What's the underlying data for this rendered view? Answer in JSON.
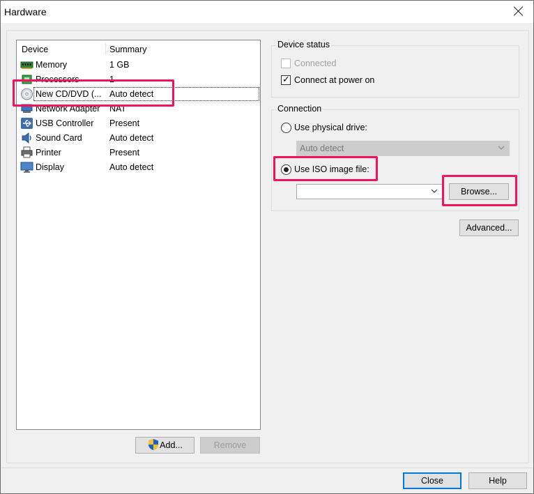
{
  "window": {
    "title": "Hardware"
  },
  "device_list": {
    "columns": {
      "device": "Device",
      "summary": "Summary"
    },
    "rows": [
      {
        "device": "Memory",
        "summary": "1 GB",
        "icon": "memory-icon"
      },
      {
        "device": "Processors",
        "summary": "1",
        "icon": "processor-icon"
      },
      {
        "device": "New CD/DVD (...",
        "summary": "Auto detect",
        "icon": "cd-dvd-icon"
      },
      {
        "device": "Network Adapter",
        "summary": "NAT",
        "icon": "network-adapter-icon"
      },
      {
        "device": "USB Controller",
        "summary": "Present",
        "icon": "usb-icon"
      },
      {
        "device": "Sound Card",
        "summary": "Auto detect",
        "icon": "sound-card-icon"
      },
      {
        "device": "Printer",
        "summary": "Present",
        "icon": "printer-icon"
      },
      {
        "device": "Display",
        "summary": "Auto detect",
        "icon": "display-icon"
      }
    ],
    "selected_index": 2
  },
  "list_buttons": {
    "add": "Add...",
    "remove": "Remove"
  },
  "device_status": {
    "label": "Device status",
    "connected": "Connected",
    "connect_at_power_on": "Connect at power on"
  },
  "connection": {
    "label": "Connection",
    "physical_drive": "Use physical drive:",
    "physical_drive_value": "Auto detect",
    "iso_image": "Use ISO image file:",
    "iso_path": "",
    "browse": "Browse..."
  },
  "advanced": "Advanced...",
  "footer": {
    "close": "Close",
    "help": "Help"
  },
  "highlight_color": "#f0145a"
}
